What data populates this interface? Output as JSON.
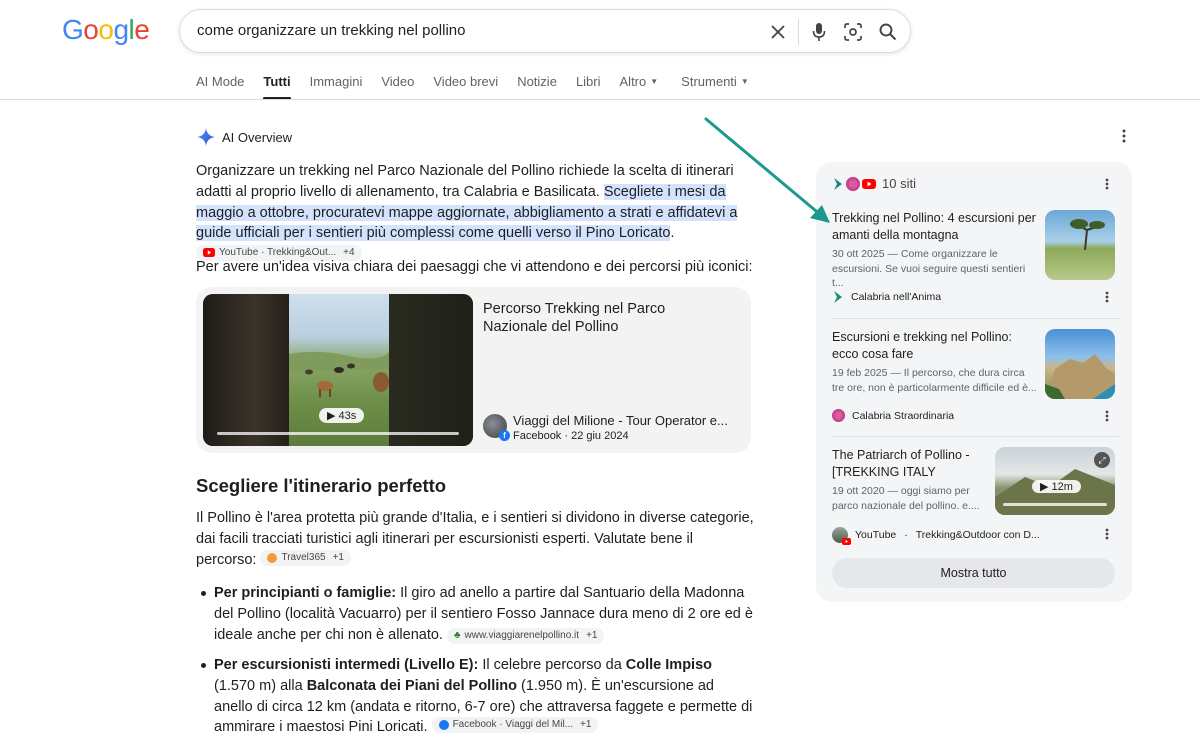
{
  "logo": "Google",
  "search": {
    "query": "come organizzare un trekking nel pollino"
  },
  "tabs": [
    {
      "label": "AI Mode"
    },
    {
      "label": "Tutti"
    },
    {
      "label": "Immagini"
    },
    {
      "label": "Video"
    },
    {
      "label": "Video brevi"
    },
    {
      "label": "Notizie"
    },
    {
      "label": "Libri"
    },
    {
      "label": "Altro"
    }
  ],
  "tools_label": "Strumenti",
  "ai_overview": {
    "title": "AI Overview",
    "intro_plain": "Organizzare un trekking nel Parco Nazionale del Pollino richiede la scelta di itinerari adatti al proprio livello di allenamento, tra Calabria e Basilicata. ",
    "intro_highlight": "Scegliete i mesi da maggio a ottobre, procuratevi mappe aggiornate, abbigliamento a strati e affidatevi a guide ufficiali per i sentieri più complessi come quelli verso il Pino Loricato",
    "intro_tail": ".",
    "intro_chip": {
      "label": "YouTube · Trekking&Out...",
      "plus": "+4"
    },
    "visual_line": "Per avere un'idea visiva chiara dei paesaggi che vi attendono e dei percorsi più iconici:",
    "video": {
      "duration": "43s",
      "title": "Percorso Trekking nel Parco Nazionale del Pollino",
      "source": "Viaggi del Milione - Tour Operator e...",
      "meta": "Facebook · 22 giu 2024"
    },
    "section_title": "Scegliere l'itinerario perfetto",
    "section_para": "Il Pollino è l'area protetta più grande d'Italia, e i sentieri si dividono in diverse categorie, dai facili tracciati turistici agli itinerari per escursionisti esperti. Valutate bene il percorso:",
    "section_chip": {
      "label": "Travel365",
      "plus": "+1"
    },
    "bullets": [
      {
        "bold": "Per principianti o famiglie:",
        "text": " Il giro ad anello a partire dal Santuario della Madonna del Pollino (località Vacuarro) per il sentiero Fosso Jannace dura meno di 2 ore ed è ideale anche per chi non è allenato.",
        "chip": "www.viaggiarenelpollino.it",
        "plus": "+1"
      },
      {
        "bold": "Per escursionisti intermedi (Livello E):",
        "text1": " Il celebre percorso da ",
        "bold2": "Colle Impiso",
        "text2": " (1.570 m) alla ",
        "bold3": "Balconata dei Piani del Pollino",
        "text3": " (1.950 m). È un'escursione ad anello di circa 12 km (andata e ritorno, 6-7 ore) che attraversa faggete e permette di ammirare i maestosi Pini Loricati.",
        "chip": "Facebook · Viaggi del Mil...",
        "plus": "+1"
      }
    ]
  },
  "sources_panel": {
    "count_label": "10 siti",
    "items": [
      {
        "title": "Trekking nel Pollino: 4 escursioni per amanti della montagna",
        "snippet": "30 ott 2025 — Come organizzare le escursioni. Se vuoi seguire questi sentieri t...",
        "site": "Calabria nell'Anima"
      },
      {
        "title": "Escursioni e trekking nel Pollino: ecco cosa fare",
        "snippet": "19 feb 2025 — Il percorso, che dura circa tre ore, non è particolarmente difficile ed è...",
        "site": "Calabria Straordinaria"
      },
      {
        "title": "The Patriarch of Pollino - [TREKKING ITALY",
        "snippet": "19 ott 2020 — oggi siamo per parco nazionale del pollino. e....",
        "duration": "12m",
        "site": "YouTube",
        "site_extra": "Trekking&Outdoor con D..."
      }
    ],
    "show_all": "Mostra tutto"
  },
  "colors": {
    "highlight": "#d3e3fd",
    "arrow": "#1a9a8e",
    "panel": "#f3f5f7"
  }
}
